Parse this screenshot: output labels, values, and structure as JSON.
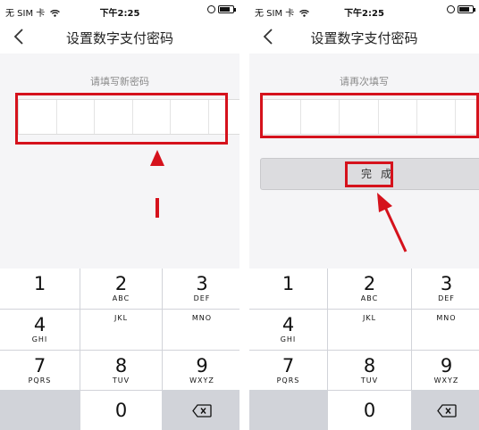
{
  "status_bar": {
    "carrier": "无 SIM 卡",
    "time": "下午2:25"
  },
  "screens": [
    {
      "nav_title": "设置数字支付密码",
      "prompt": "请填写新密码"
    },
    {
      "nav_title": "设置数字支付密码",
      "prompt": "请再次填写",
      "done_label": "完成"
    }
  ],
  "keypad": {
    "keys": [
      {
        "digit": "1",
        "letters": ""
      },
      {
        "digit": "2",
        "letters": "ABC"
      },
      {
        "digit": "3",
        "letters": "DEF"
      },
      {
        "digit": "4",
        "letters": "GHI"
      },
      {
        "digit": "",
        "letters": "JKL"
      },
      {
        "digit": "",
        "letters": "MNO"
      },
      {
        "digit": "7",
        "letters": "PQRS"
      },
      {
        "digit": "8",
        "letters": "TUV"
      },
      {
        "digit": "9",
        "letters": "WXYZ"
      },
      {
        "digit": "0",
        "letters": ""
      }
    ]
  },
  "colors": {
    "highlight": "#d5121c",
    "keypad_bg": "#d1d3d9",
    "screen_bg": "#f5f5f7"
  },
  "icons": {
    "back": "chevron-left-icon",
    "wifi": "wifi-icon",
    "battery": "battery-icon",
    "delete": "backspace-icon"
  }
}
